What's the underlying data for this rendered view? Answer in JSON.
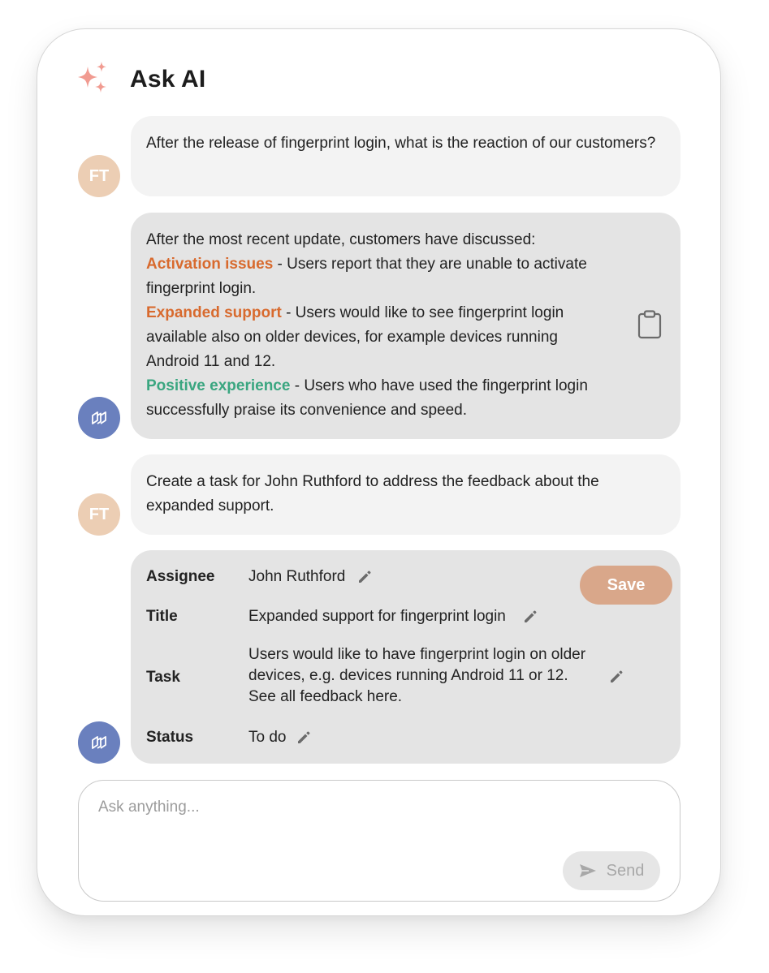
{
  "header": {
    "title": "Ask AI",
    "icon": "sparkles-icon",
    "icon_color": "#f19b91"
  },
  "messages": [
    {
      "role": "user",
      "avatar": "FT",
      "text": "After the release of fingerprint login, what is the reaction of our customers?"
    },
    {
      "role": "assistant",
      "intro": "After the most recent update, customers have discussed:",
      "items": [
        {
          "title": "Activation issues",
          "body": " - Users report that they are unable to activate fingerprint login.",
          "color": "#d86a2e"
        },
        {
          "title": "Expanded support",
          "body": " - Users would like to see fingerprint login available also on older devices, for example devices running Android 11 and 12.",
          "color": "#d86a2e"
        },
        {
          "title": "Positive experience",
          "body": " - Users who have used the fingerprint login successfully praise its convenience and speed.",
          "color": "#3aa680"
        }
      ],
      "copy_icon": "clipboard-icon"
    },
    {
      "role": "user",
      "avatar": "FT",
      "text": "Create a task for John Ruthford to address the feedback about the expanded support."
    },
    {
      "role": "assistant",
      "task": {
        "assignee_label": "Assignee",
        "assignee": "John Ruthford",
        "title_label": "Title",
        "title": "Expanded support for fingerprint login",
        "task_label": "Task",
        "task": "Users would like to have fingerprint login on older devices, e.g. devices running Android 11 or 12. See all feedback here.",
        "status_label": "Status",
        "status": "To do",
        "save_label": "Save"
      }
    }
  ],
  "composer": {
    "placeholder": "Ask anything...",
    "send_label": "Send"
  },
  "colors": {
    "user_bubble": "#f3f3f3",
    "ai_bubble": "#e4e4e4",
    "user_avatar": "#ecceb4",
    "ai_avatar": "#6a80be",
    "save_button": "#d9a78a"
  }
}
